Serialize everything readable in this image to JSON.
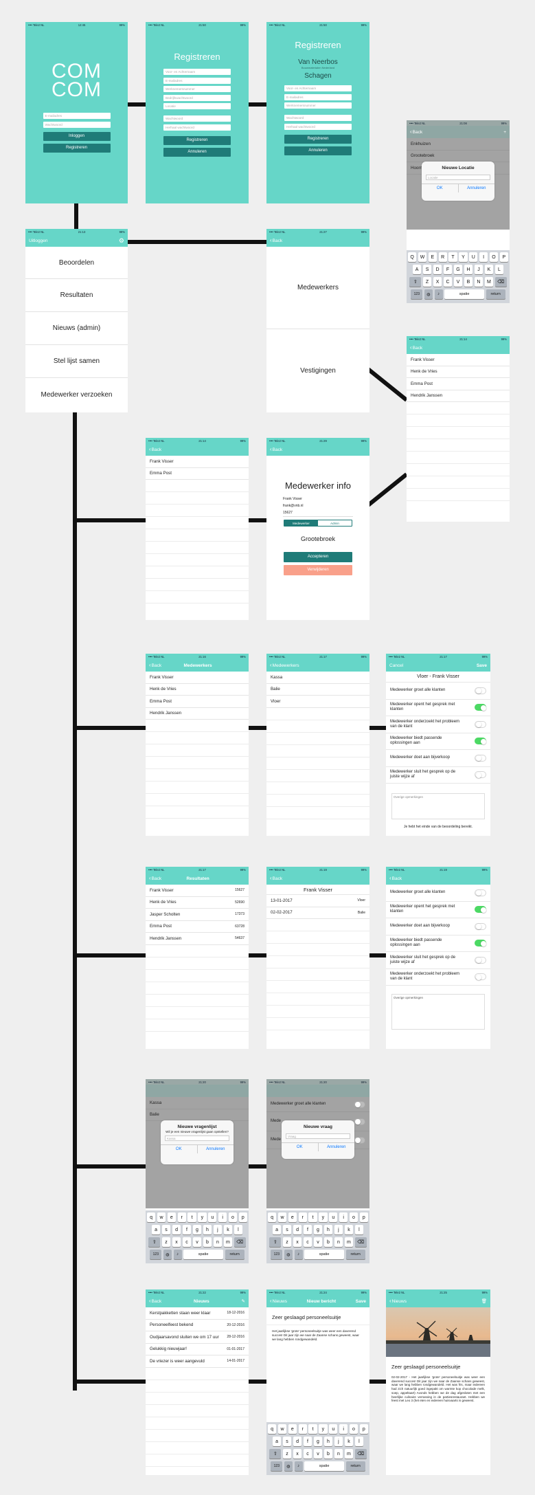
{
  "status": {
    "carrier": "•••• Tele2 NL",
    "wifi": "WiFi",
    "battery": "99%"
  },
  "s1": {
    "logo1": "COM",
    "logo2": "COM",
    "email": "E-mailadres",
    "password": "Wachtwoord",
    "login": "Inloggen",
    "register": "Registreren",
    "time": "12:45"
  },
  "s2": {
    "title": "Registreren",
    "f": [
      "Voor- en Achternaam",
      "E-mailadres",
      "Werknemersnummer",
      "Bedrijfswachtwoord",
      "Locatie",
      "Wachtwoord",
      "Herhaal wachtwoord"
    ],
    "register": "Registreren",
    "cancel": "Annuleren",
    "time": "21:50"
  },
  "s3": {
    "title": "Registreren",
    "company": "Van Neerbos",
    "sub": "Bouwmaterialen Nederland",
    "loc": "Schagen",
    "f": [
      "Voor- en Achternaam",
      "E-mailadres",
      "Werknemersnummer",
      "Wachtwoord",
      "Herhaal wachtwoord"
    ],
    "register": "Registreren",
    "cancel": "Annuleren",
    "time": "21:50"
  },
  "s4": {
    "back": "Back",
    "rows": [
      "Enkhuizen",
      "Grootebroek",
      "Hoorn"
    ],
    "alert_title": "Nieuwe Locatie",
    "alert_placeholder": "Locatie",
    "ok": "OK",
    "cancel": "Annuleren",
    "time": "21:08"
  },
  "keyboard_upper": {
    "r1": [
      "Q",
      "W",
      "E",
      "R",
      "T",
      "Y",
      "U",
      "I",
      "O",
      "P"
    ],
    "r2": [
      "A",
      "S",
      "D",
      "F",
      "G",
      "H",
      "J",
      "K",
      "L"
    ],
    "r3": [
      "Z",
      "X",
      "C",
      "V",
      "B",
      "N",
      "M"
    ],
    "num": "123",
    "space": "spatie",
    "ret": "return"
  },
  "keyboard_lower": {
    "r1": [
      "q",
      "w",
      "e",
      "r",
      "t",
      "y",
      "u",
      "i",
      "o",
      "p"
    ],
    "r2": [
      "a",
      "s",
      "d",
      "f",
      "g",
      "h",
      "j",
      "k",
      "l"
    ],
    "r3": [
      "z",
      "x",
      "c",
      "v",
      "b",
      "n",
      "m"
    ],
    "num": "123",
    "space": "spatie",
    "ret": "return"
  },
  "menu": {
    "logout": "Uitloggen",
    "items": [
      "Beoordelen",
      "Resultaten",
      "Nieuws (admin)",
      "Stel lijst samen",
      "Medewerker verzoeken"
    ],
    "time": "21:13"
  },
  "admin": {
    "back": "Back",
    "items": [
      "Medewerkers",
      "Vestigingen"
    ],
    "time": "21:27"
  },
  "emp_list": {
    "back": "Back",
    "rows": [
      "Frank Visser",
      "Henk de Vries",
      "Emma Post",
      "Hendrik Janssen"
    ],
    "time": "21:14"
  },
  "req_list": {
    "back": "Back",
    "rows": [
      "Frank Visser",
      "Emma Post"
    ],
    "time": "21:14"
  },
  "emp_info": {
    "back": "Back",
    "title": "Medewerker info",
    "name": "Frank Visser",
    "email": "frank@vnb.nl",
    "number": "15627",
    "seg": [
      "Medewerker",
      "Admin"
    ],
    "loc": "Grootebroek",
    "accept": "Accepteren",
    "reject": "Verwijderen",
    "time": "21:29"
  },
  "beoordeel1": {
    "back": "Back",
    "title": "Medewerkers",
    "rows": [
      "Frank Visser",
      "Henk de Vries",
      "Emma Post",
      "Hendrik Janssen"
    ],
    "time": "21:16"
  },
  "beoordeel2": {
    "back": "Medewerkers",
    "rows": [
      "Kassa",
      "Balie",
      "Vloer"
    ],
    "time": "21:17"
  },
  "beoordeel3": {
    "cancel": "Cancel",
    "save": "Save",
    "title": "Vloer - Frank Visser",
    "q": [
      {
        "t": "Medewerker groet alle klanten",
        "on": false
      },
      {
        "t": "Medewerker opent het gesprek met klanten",
        "on": true
      },
      {
        "t": "Medewerker onderzoekt het probleem van de klant",
        "on": false
      },
      {
        "t": "Medewerker biedt passende oplossingen aan",
        "on": true
      },
      {
        "t": "Medewerker doet aan bijverkoop",
        "on": false
      },
      {
        "t": "Medewerker sluit het gesprek op de juiste wijze af",
        "on": false
      }
    ],
    "notes": "Overige opmerkingen",
    "end": "Je hebt het einde van de beoordeling bereikt.",
    "time": "21:17"
  },
  "res1": {
    "back": "Back",
    "title": "Resultaten",
    "rows": [
      {
        "n": "Frank Visser",
        "v": "15627"
      },
      {
        "n": "Henk de Vries",
        "v": "52690"
      },
      {
        "n": "Jasper Scholten",
        "v": "17373"
      },
      {
        "n": "Emma Post",
        "v": "63728"
      },
      {
        "n": "Hendrik Janssen",
        "v": "54637"
      }
    ],
    "time": "21:17"
  },
  "res2": {
    "back": "Back",
    "title": "Frank Visser",
    "rows": [
      {
        "d": "13-01-2017",
        "p": "Vloer"
      },
      {
        "d": "02-02-2017",
        "p": "Balie"
      }
    ],
    "time": "21:19"
  },
  "res3": {
    "back": "Back",
    "q": [
      {
        "t": "Medewerker groet alle klanten",
        "on": false
      },
      {
        "t": "Medewerker opent het gesprek met klanten",
        "on": true
      },
      {
        "t": "Medewerker doet aan bijverkoop",
        "on": false
      },
      {
        "t": "Medewerker biedt passende oplossingen aan",
        "on": true
      },
      {
        "t": "Medewerker sluit het gesprek op de juiste wijze af",
        "on": false
      },
      {
        "t": "Medewerker onderzoekt het probleem van de klant",
        "on": false
      }
    ],
    "notes": "Overige opmerkingen",
    "time": "21:19"
  },
  "list1": {
    "rows": [
      "Kassa",
      "Balie"
    ],
    "alert_title": "Nieuwe vragenlijst",
    "alert_sub": "Wil je een nieuwe vragenlijst gaan opstellen?",
    "alert_placeholder": "Kassa",
    "ok": "OK",
    "cancel": "Annuleren",
    "time": "21:20"
  },
  "list2": {
    "rows": [
      "Medewerker groet alle klanten",
      "Mede",
      "Mede",
      "probl"
    ],
    "alert_title": "Nieuwe vraag",
    "alert_placeholder": "Vraag",
    "ok": "OK",
    "cancel": "Annuleren",
    "time": "21:20"
  },
  "news1": {
    "back": "Back",
    "title": "Nieuws",
    "rows": [
      {
        "t": "Kerstpakketten staan weer klaar",
        "d": "18-12-2016"
      },
      {
        "t": "Personeelfeest bekend",
        "d": "20-12-2016"
      },
      {
        "t": "Oudjaarsavond sluiten we om 17 uur",
        "d": "28-12-2016"
      },
      {
        "t": "Gelukkig nieuwjaar!",
        "d": "01-01-2017"
      },
      {
        "t": "De vriezer is weer aangevuld",
        "d": "14-01-2017"
      }
    ],
    "time": "21:22"
  },
  "news2": {
    "back": "Nieuws",
    "title": "Nieuw bericht",
    "save": "Save",
    "headline": "Zeer geslaagd personeelsuitje",
    "body": "Het jaarlijkse 'grote' personeelsuitje was weer een daverend succes! Dit jaar zijn we naar de Zaanse schans geweest, waar we lang hebben rondgewandeld.",
    "time": "21:24"
  },
  "news3": {
    "back": "Nieuws",
    "headline": "Zeer geslaagd personeelsuitje",
    "body": "02-02-2017 - Het jaarlijkse 'grote' personeelsuitje was weer een daverend succes! Dit jaar zijn we naar de Zaanse schans geweest, waar we lang hebben rondgewandeld. Het was fris, maar iedereen had zich natuurlijk goed ingepakt om warmte kop chocolade melk, soep, appeltaart) Avonds hebben we de dag afgesloten met een heerlijke culinaire verrassing in de partiesrestaurant. Hebben we feest met Leo 3 (het eten en iedereen huisvaarts is geweest.",
    "time": "21:25"
  }
}
